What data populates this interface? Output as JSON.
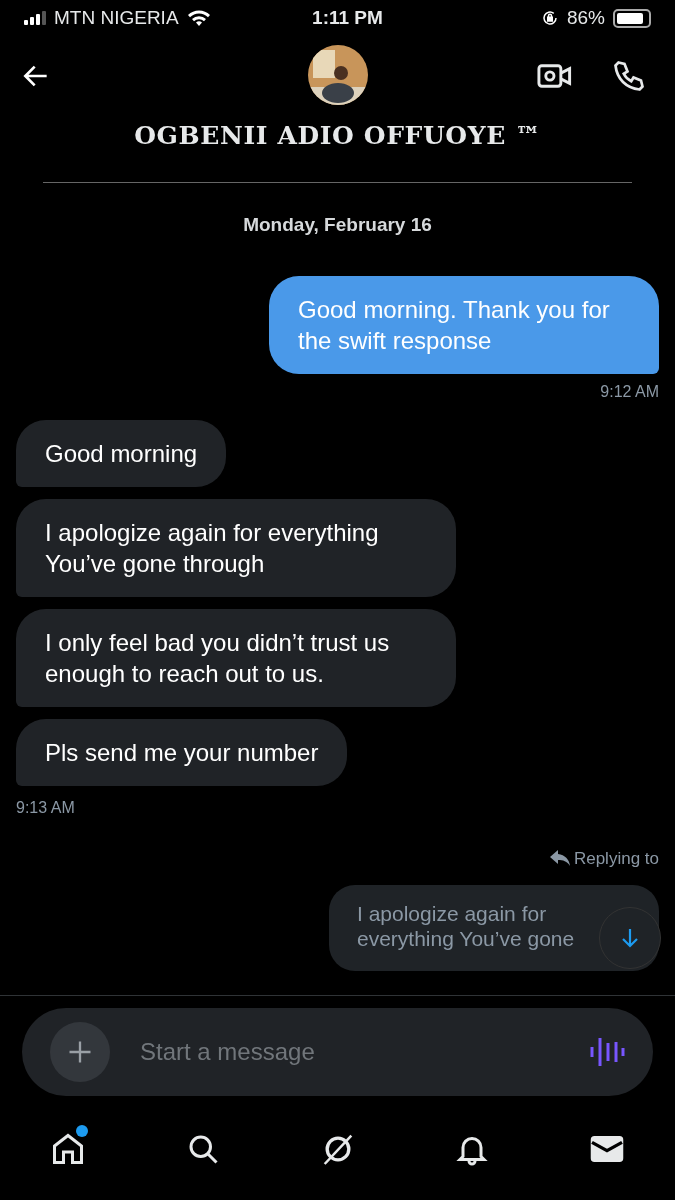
{
  "status_bar": {
    "carrier": "MTN NIGERIA",
    "time": "1:11 PM",
    "battery": "86%"
  },
  "header": {
    "title": "OGBENII ADIO OFFUOYE ™"
  },
  "date": "Monday, February 16",
  "messages": [
    {
      "kind": "sent",
      "text": "Good morning. Thank you for the swift response"
    },
    {
      "kind": "time_sent",
      "text": "9:12 AM"
    },
    {
      "kind": "received",
      "text": "Good morning"
    },
    {
      "kind": "received",
      "text": "I apologize again for everything You’ve gone through"
    },
    {
      "kind": "received",
      "text": "I only feel bad you didn’t trust us enough to reach out to us."
    },
    {
      "kind": "received",
      "text": "Pls send me your number"
    },
    {
      "kind": "time_received",
      "text": "9:13 AM"
    },
    {
      "kind": "reply",
      "label": "Replying to",
      "quote": "I apologize again for everything You’ve gone"
    }
  ],
  "composer": {
    "placeholder": "Start a message"
  },
  "nav": [
    {
      "kind": "home",
      "selected": false,
      "badge": true
    },
    {
      "kind": "search",
      "selected": false,
      "badge": false
    },
    {
      "kind": "explore",
      "selected": false,
      "badge": false
    },
    {
      "kind": "bell",
      "selected": false,
      "badge": false
    },
    {
      "kind": "mail",
      "selected": true,
      "badge": false
    }
  ]
}
